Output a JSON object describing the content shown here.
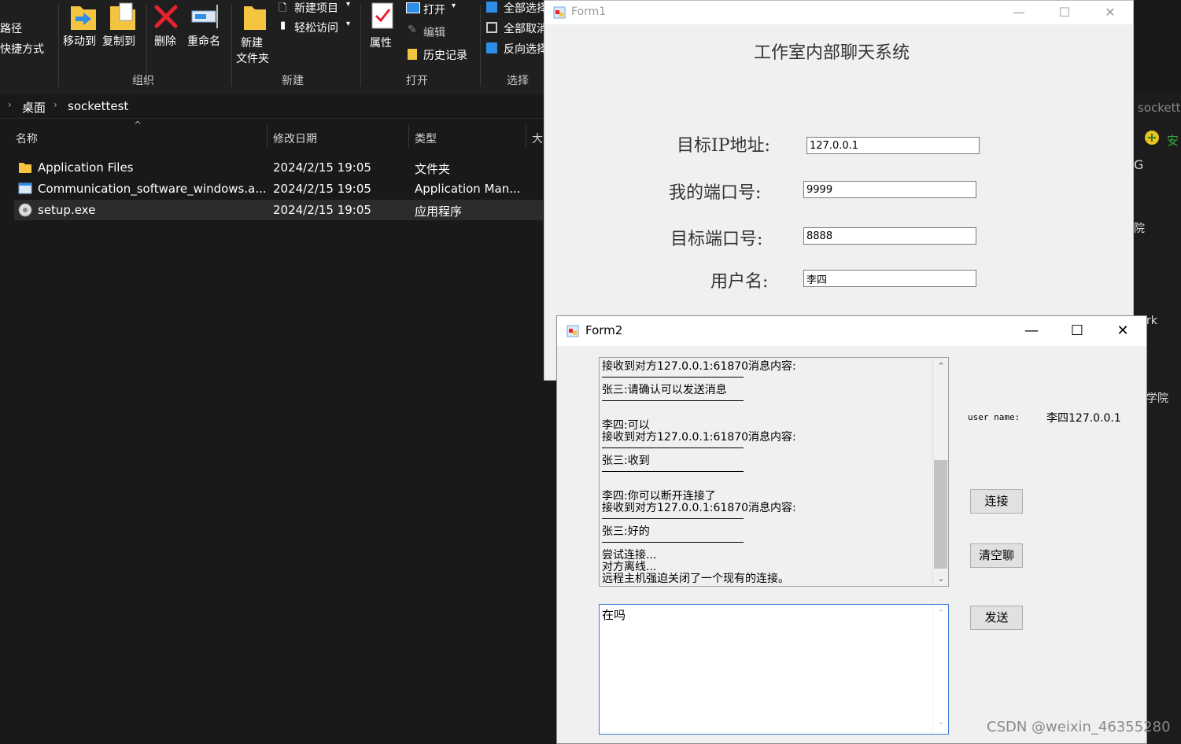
{
  "explorer": {
    "ribbon": {
      "left_partial": [
        "路径",
        "快捷方式"
      ],
      "move_to": "移动到",
      "copy_to": "复制到",
      "delete": "删除",
      "rename": "重命名",
      "new_folder_line1": "新建",
      "new_folder_line2": "文件夹",
      "new_item": "新建项目",
      "easy_access": "轻松访问",
      "properties": "属性",
      "open": "打开",
      "edit": "编辑",
      "history": "历史记录",
      "select_all": "全部选择",
      "select_none": "全部取消",
      "invert_selection": "反向选择",
      "groups": [
        "组织",
        "新建",
        "打开",
        "选择"
      ]
    },
    "breadcrumb": [
      "桌面",
      "sockettest"
    ],
    "columns": [
      "名称",
      "修改日期",
      "类型",
      "大"
    ],
    "files": [
      {
        "name": "Application Files",
        "date": "2024/2/15 19:05",
        "type": "文件夹",
        "icon": "folder-icon"
      },
      {
        "name": "Communication_software_windows.a...",
        "date": "2024/2/15 19:05",
        "type": "Application Man...",
        "icon": "manifest-file-icon"
      },
      {
        "name": "setup.exe",
        "date": "2024/2/15 19:05",
        "type": "应用程序",
        "icon": "setup-exe-icon"
      }
    ],
    "right_partial": [
      "sockett",
      "安",
      "G",
      "院",
      "rk",
      "学院"
    ]
  },
  "form1": {
    "title": "Form1",
    "heading": "工作室内部聊天系统",
    "fields": [
      {
        "label": "目标IP地址:",
        "value": "127.0.0.1"
      },
      {
        "label": "我的端口号:",
        "value": "9999"
      },
      {
        "label": "目标端口号:",
        "value": "8888"
      },
      {
        "label": "用户名:",
        "value": "李四"
      }
    ]
  },
  "form2": {
    "title": "Form2",
    "chat_lines": [
      "接收到对方127.0.0.1:61870消息内容:",
      "张三:请确认可以发送消息",
      "李四:可以",
      "接收到对方127.0.0.1:61870消息内容:",
      "张三:收到",
      "李四:你可以断开连接了",
      "接收到对方127.0.0.1:61870消息内容:",
      "张三:好的",
      "尝试连接...",
      "对方离线...",
      "远程主机强迫关闭了一个现有的连接。"
    ],
    "input_text": "在吗",
    "user_name_label": "user name:",
    "user_name_value": "李四127.0.0.1",
    "connect_button": "连接",
    "clear_button": "清空聊",
    "send_button": "发送"
  },
  "watermark": "CSDN @weixin_46355280"
}
